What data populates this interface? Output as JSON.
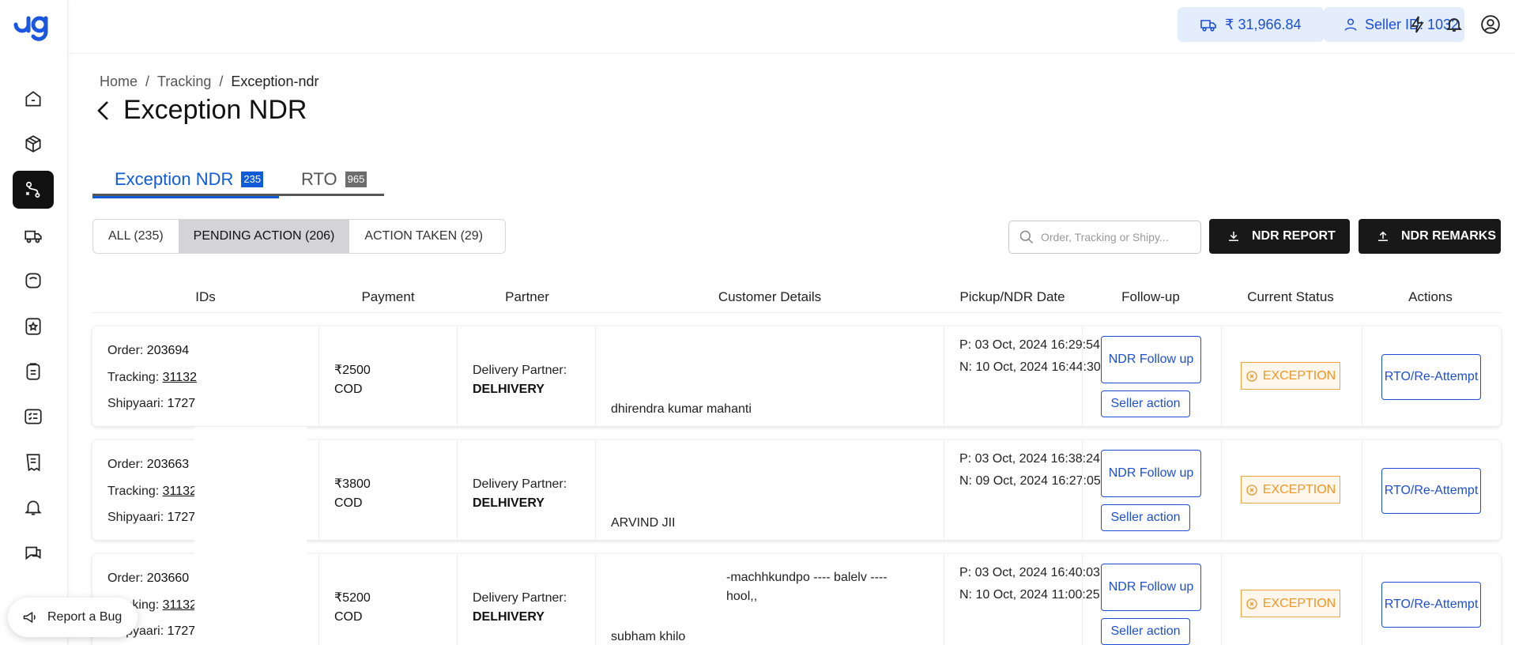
{
  "topbar": {
    "wallet_amount": "₹ 31,966.84",
    "seller_id": "Seller ID: 1032",
    "icons": [
      "flash-icon",
      "bell-icon",
      "user-circle-icon"
    ]
  },
  "sidebar": {
    "items": [
      {
        "icon": "home-icon"
      },
      {
        "icon": "box-icon"
      },
      {
        "icon": "route-icon",
        "active": true
      },
      {
        "icon": "truck-icon"
      },
      {
        "icon": "wallet-icon"
      },
      {
        "icon": "badge-icon"
      },
      {
        "icon": "clipboard-icon"
      },
      {
        "icon": "checklist-icon"
      },
      {
        "icon": "receipt-icon"
      },
      {
        "icon": "bell-icon"
      },
      {
        "icon": "chat-icon"
      }
    ]
  },
  "breadcrumb": {
    "home": "Home",
    "tracking": "Tracking",
    "current": "Exception-ndr",
    "sep": "/"
  },
  "page": {
    "title": "Exception NDR"
  },
  "tabs": {
    "exception": {
      "label": "Exception NDR",
      "count": "235"
    },
    "rto": {
      "label": "RTO",
      "count": "965"
    }
  },
  "filters": [
    "ALL (235)",
    "PENDING ACTION (206)",
    "ACTION TAKEN (29)"
  ],
  "search": {
    "placeholder": "Order, Tracking or Shipy..."
  },
  "buttons": {
    "ndr_report": "NDR REPORT",
    "ndr_remarks": "NDR REMARKS"
  },
  "columns": {
    "ids": "IDs",
    "payment": "Payment",
    "partner": "Partner",
    "customer": "Customer Details",
    "dates": "Pickup/NDR Date",
    "followup": "Follow-up",
    "status": "Current Status",
    "actions": "Actions"
  },
  "labels": {
    "order": "Order: ",
    "tracking": "Tracking: ",
    "shipyaari": "Shipyaari: ",
    "delivery_partner": "Delivery Partner:",
    "ndr_followup": "NDR Follow up",
    "seller_action": "Seller action",
    "rto_reattempt": "RTO/Re-Attempt"
  },
  "rows": [
    {
      "order": "203694",
      "tracking": "31132",
      "shipyaari": "1727",
      "amount": "₹2500",
      "mode": "COD",
      "partner": "DELHIVERY",
      "customer": "dhirendra kumar mahanti",
      "address": "",
      "pickup": "P: 03 Oct, 2024 16:29:54",
      "ndr": "N: 10 Oct, 2024 16:44:30",
      "status": "EXCEPTION"
    },
    {
      "order": "203663",
      "tracking": "31132",
      "shipyaari": "1727",
      "amount": "₹3800",
      "mode": "COD",
      "partner": "DELHIVERY",
      "customer": "ARVIND JII",
      "address": "",
      "pickup": "P: 03 Oct, 2024 16:38:24",
      "ndr": "N: 09 Oct, 2024 16:27:05",
      "status": "EXCEPTION"
    },
    {
      "order": "203660",
      "tracking": "31132",
      "shipyaari": "1727",
      "amount": "₹5200",
      "mode": "COD",
      "partner": "DELHIVERY",
      "customer": "subham khilo",
      "address": "-machhkundpo ---- balelv ---- hool,,",
      "pickup": "P: 03 Oct, 2024 16:40:03",
      "ndr": "N: 10 Oct, 2024 11:00:25",
      "status": "EXCEPTION"
    }
  ],
  "report_bug": "Report a Bug",
  "colors": {
    "accent": "#0f5bd8",
    "exception": "#f0962a",
    "dark_button": "#181818"
  }
}
